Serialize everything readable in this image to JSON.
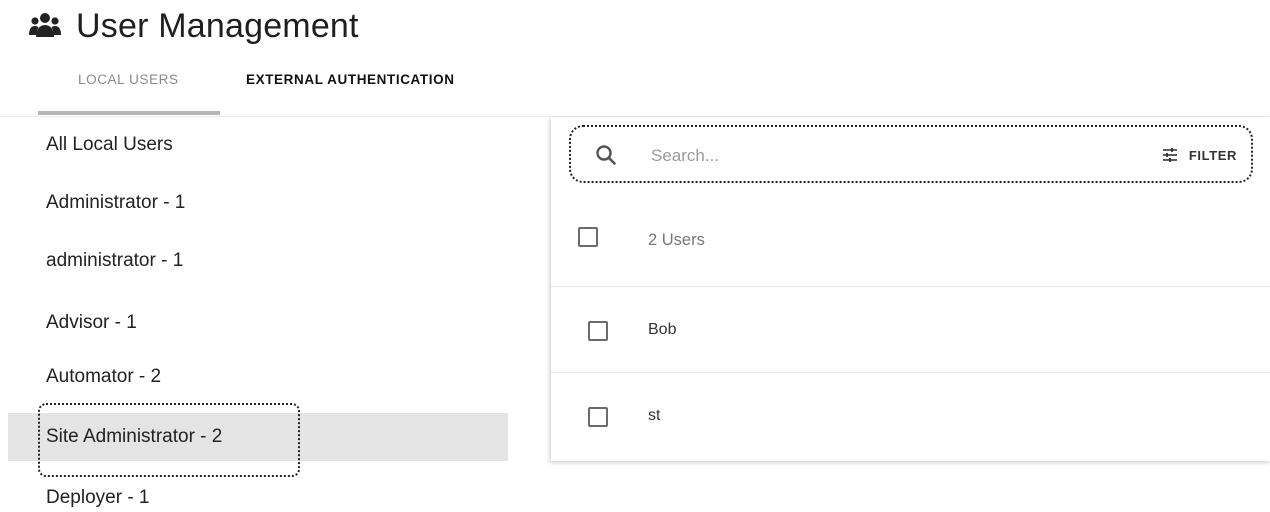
{
  "header": {
    "title": "User Management",
    "icon": "users-icon"
  },
  "tabs": [
    {
      "label": "LOCAL USERS",
      "active": true
    },
    {
      "label": "EXTERNAL AUTHENTICATION",
      "active": false
    }
  ],
  "sidebar": {
    "items": [
      {
        "label": "All Local Users",
        "selected": false
      },
      {
        "label": "Administrator - 1",
        "selected": false
      },
      {
        "label": "administrator - 1",
        "selected": false
      },
      {
        "label": "Advisor - 1",
        "selected": false
      },
      {
        "label": "Automator - 2",
        "selected": false
      },
      {
        "label": "Site Administrator - 2",
        "selected": true
      },
      {
        "label": "Deployer - 1",
        "selected": false
      }
    ]
  },
  "search": {
    "placeholder": "Search...",
    "value": "",
    "filter_label": "FILTER"
  },
  "table": {
    "count_label": "2 Users",
    "rows": [
      {
        "name": "Bob",
        "checked": false
      },
      {
        "name": "st",
        "checked": false
      }
    ]
  },
  "colors": {
    "selected_bg": "#e4e4e4",
    "active_tab_underline": "#b7b7b7",
    "inactive_tab_text": "#8a8a8a"
  }
}
